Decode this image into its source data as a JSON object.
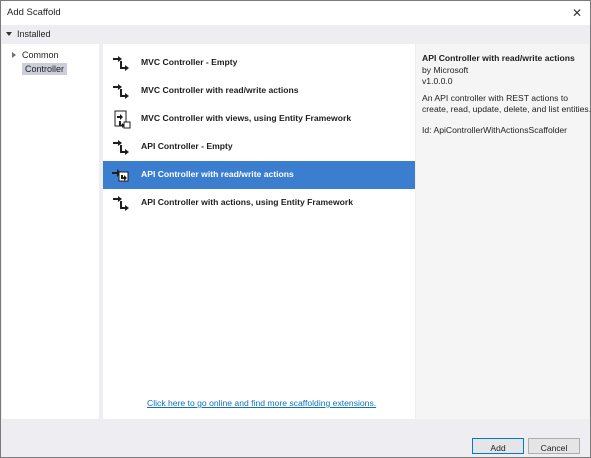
{
  "window": {
    "title": "Add Scaffold",
    "close_glyph": "✕"
  },
  "tree": {
    "installed_label": "Installed",
    "items": [
      {
        "label": "Common"
      },
      {
        "label": "Controller",
        "selected": true
      }
    ]
  },
  "list": {
    "items": [
      {
        "label": "MVC Controller - Empty",
        "icon": "controller-icon"
      },
      {
        "label": "MVC Controller with read/write actions",
        "icon": "controller-icon"
      },
      {
        "label": "MVC Controller with views, using Entity Framework",
        "icon": "controller-views-icon"
      },
      {
        "label": "API Controller - Empty",
        "icon": "controller-icon"
      },
      {
        "label": "API Controller with read/write actions",
        "icon": "api-controller-icon",
        "selected": true
      },
      {
        "label": "API Controller with actions, using Entity Framework",
        "icon": "controller-icon"
      }
    ],
    "online_link": "Click here to go online and find more scaffolding extensions."
  },
  "details": {
    "title": "API Controller with read/write actions",
    "author": "by Microsoft",
    "version": "v1.0.0.0",
    "description_line1": "An API controller with REST actions to",
    "description_line2": "create, read, update, delete, and list entities.",
    "id_line": "Id: ApiControllerWithActionsScaffolder"
  },
  "buttons": {
    "add": "Add",
    "cancel": "Cancel"
  },
  "colors": {
    "selection": "#3b7ecf",
    "link": "#0e70c0",
    "dialog_bg": "#eeeef2"
  }
}
